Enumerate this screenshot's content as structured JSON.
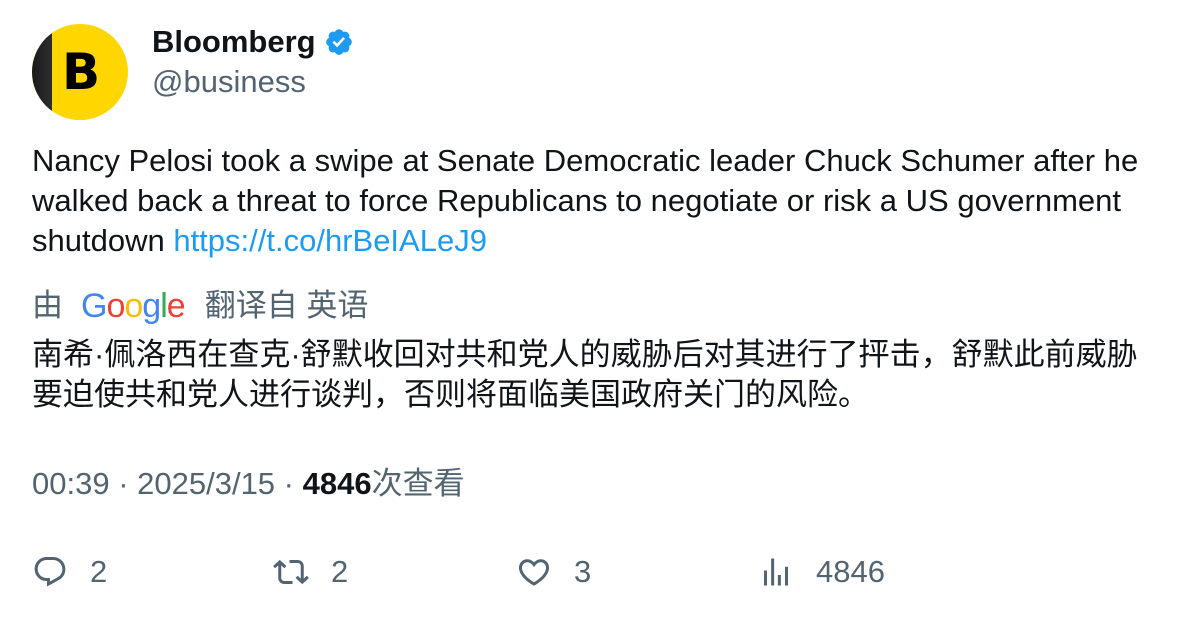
{
  "author": {
    "display_name": "Bloomberg",
    "handle": "@business",
    "avatar_letter": "B",
    "verified_icon": "verified-badge-icon",
    "brand_color": "#FFD600",
    "verified_color": "#1d9bf0"
  },
  "tweet": {
    "text": "Nancy Pelosi took a swipe at Senate Democratic leader Chuck Schumer after he walked back a threat to force Republicans to negotiate or risk a US government shutdown ",
    "link": "https://t.co/hrBeIALeJ9",
    "link_color": "#1d9bf0"
  },
  "translation": {
    "prefix": "由",
    "provider_logo": [
      "G",
      "o",
      "o",
      "g",
      "l",
      "e"
    ],
    "provider_colors": [
      "#4285F4",
      "#EA4335",
      "#FBBC05",
      "#4285F4",
      "#34A853",
      "#EA4335"
    ],
    "suffix": "翻译自 英语",
    "text": "南希·佩洛西在查克·舒默收回对共和党人的威胁后对其进行了抨击，舒默此前威胁要迫使共和党人进行谈判，否则将面临美国政府关门的风险。"
  },
  "meta": {
    "time": "00:39",
    "separator": " · ",
    "date": "2025/3/15",
    "views_count": "4846",
    "views_label": "次查看"
  },
  "actions": {
    "replies": {
      "icon": "reply-icon",
      "count": "2"
    },
    "retweets": {
      "icon": "retweet-icon",
      "count": "2"
    },
    "likes": {
      "icon": "heart-icon",
      "count": "3"
    },
    "views": {
      "icon": "analytics-icon",
      "count": "4846"
    }
  }
}
